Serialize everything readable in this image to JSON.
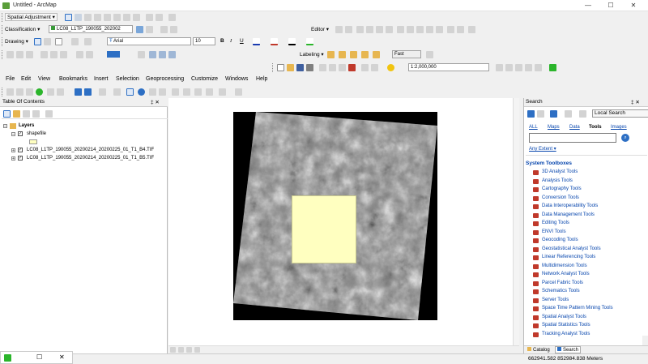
{
  "window": {
    "title": "Untitled - ArcMap",
    "minimize": "—",
    "maximize": "☐",
    "close": "✕"
  },
  "toolbars": {
    "spatial_adjustment": "Spatial Adjustment ▾",
    "classification": "Classification ▾",
    "classification_layer": "LC08_L1TP_190055_202002",
    "drawing": "Drawing ▾",
    "font": "Arial",
    "font_size": "10",
    "bold": "B",
    "italic": "I",
    "underline": "U",
    "editor": "Editor ▾",
    "labeling": "Labeling ▾",
    "fast": "Fast",
    "scale": "1:2,000,000"
  },
  "menu": [
    "File",
    "Edit",
    "View",
    "Bookmarks",
    "Insert",
    "Selection",
    "Geoprocessing",
    "Customize",
    "Windows",
    "Help"
  ],
  "toc": {
    "title": "Table Of Contents",
    "pin": "‡ ✕",
    "root": "Layers",
    "layers": [
      "shapefile",
      "LC08_L1TP_190055_20200214_20200225_01_T1_B4.TIF",
      "LC08_L1TP_190055_20200214_20200225_01_T1_B5.TIF"
    ]
  },
  "search": {
    "title": "Search",
    "pin": "‡ ✕",
    "scope": "Local Search",
    "filters": [
      "ALL",
      "Maps",
      "Data",
      "Tools",
      "Images"
    ],
    "active_filter": "Tools",
    "any_extent": "Any Extent ▾",
    "section_title": "System Toolboxes",
    "tools": [
      "3D Analyst Tools",
      "Analysis Tools",
      "Cartography Tools",
      "Conversion Tools",
      "Data Interoperability Tools",
      "Data Management Tools",
      "Editing Tools",
      "ENVI Tools",
      "Geocoding Tools",
      "Geostatistical Analyst Tools",
      "Linear Referencing Tools",
      "Multidimension Tools",
      "Network Analyst Tools",
      "Parcel Fabric Tools",
      "Schematics Tools",
      "Server Tools",
      "Space Time Pattern Mining Tools",
      "Spatial Analyst Tools",
      "Spatial Statistics Tools",
      "Tracking Analyst Tools"
    ],
    "tabs": [
      "Catalog",
      "Search"
    ]
  },
  "status": {
    "coords": "662941.582  852984.838 Meters"
  },
  "colors": {
    "shapefile_fill": "#ffffc0",
    "raster_bg": "#000000",
    "link": "#0645ad",
    "section": "#0645ad"
  }
}
